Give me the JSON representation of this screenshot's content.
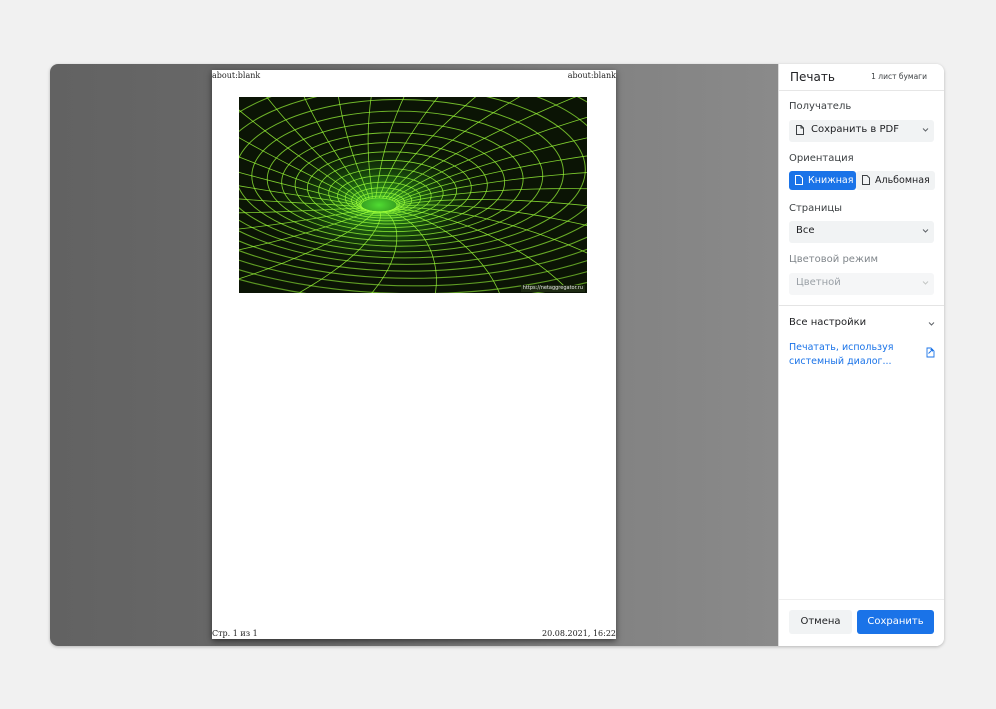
{
  "preview": {
    "header_left": "about:blank",
    "header_right": "about:blank",
    "footer_left": "Стр. 1 из 1",
    "footer_right": "20.08.2021, 16:22",
    "image_watermark": "https://netaggregator.ru"
  },
  "sidebar": {
    "title": "Печать",
    "sheets": "1 лист бумаги",
    "destination_label": "Получатель",
    "destination_value": "Сохранить в PDF",
    "orientation_label": "Ориентация",
    "orientation_portrait": "Книжная",
    "orientation_landscape": "Альбомная",
    "orientation_selected": "portrait",
    "pages_label": "Страницы",
    "pages_value": "Все",
    "color_label": "Цветовой режим",
    "color_value": "Цветной",
    "more_settings": "Все настройки",
    "system_dialog_link": "Печатать, используя системный диалог..."
  },
  "buttons": {
    "cancel": "Отмена",
    "save": "Сохранить"
  },
  "colors": {
    "accent": "#1a73e8",
    "grid_green": "#9dff3a",
    "preview_background": "#6a6a6a"
  },
  "icons": [
    "document-icon",
    "chevron-down-icon",
    "portrait-page-icon",
    "landscape-page-icon",
    "external-link-icon"
  ]
}
